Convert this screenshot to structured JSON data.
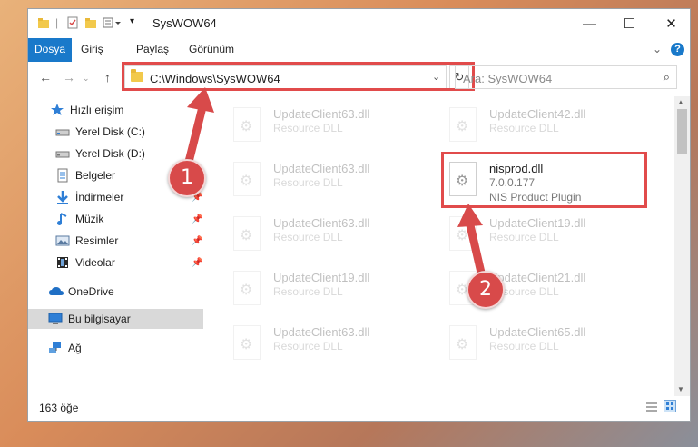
{
  "window": {
    "title": "SysWOW64",
    "controls": {
      "minimize": "—",
      "maximize": "☐",
      "close": "✕"
    }
  },
  "ribbon": {
    "tabs": [
      "Dosya",
      "Giriş",
      "Paylaş",
      "Görünüm"
    ],
    "collapse": "⌄",
    "help": "?"
  },
  "address": {
    "path": "C:\\Windows\\SysWOW64",
    "search_placeholder": "Ara: SysWOW64"
  },
  "sidebar": {
    "items": [
      {
        "label": "Hızlı erişim",
        "icon": "star-icon",
        "pinned": false
      },
      {
        "label": "Yerel Disk (C:)",
        "icon": "drive-icon",
        "pinned": false
      },
      {
        "label": "Yerel Disk (D:)",
        "icon": "drive-icon",
        "pinned": false
      },
      {
        "label": "Belgeler",
        "icon": "documents-icon",
        "pinned": true
      },
      {
        "label": "İndirmeler",
        "icon": "download-icon",
        "pinned": true
      },
      {
        "label": "Müzik",
        "icon": "music-icon",
        "pinned": true
      },
      {
        "label": "Resimler",
        "icon": "pictures-icon",
        "pinned": true
      },
      {
        "label": "Videolar",
        "icon": "videos-icon",
        "pinned": true
      },
      {
        "label": "OneDrive",
        "icon": "cloud-icon",
        "pinned": false
      },
      {
        "label": "Bu bilgisayar",
        "icon": "computer-icon",
        "pinned": false
      },
      {
        "label": "Ağ",
        "icon": "network-icon",
        "pinned": false
      }
    ]
  },
  "files": [
    {
      "name": "UpdateClient63.dll",
      "type": "Resource DLL",
      "faded": true
    },
    {
      "name": "UpdateClient42.dll",
      "type": "Resource DLL",
      "faded": true
    },
    {
      "name": "UpdateClient63.dll",
      "type": "Resource DLL",
      "faded": true
    },
    {
      "name": "nisprod.dll",
      "type": "7.0.0.177",
      "desc": "NIS Product Plugin",
      "faded": false
    },
    {
      "name": "UpdateClient63.dll",
      "type": "Resource DLL",
      "faded": true
    },
    {
      "name": "UpdateClient19.dll",
      "type": "Resource DLL",
      "faded": true
    },
    {
      "name": "UpdateClient19.dll",
      "type": "Resource DLL",
      "faded": true
    },
    {
      "name": "UpdateClient21.dll",
      "type": "Resource DLL",
      "faded": true
    },
    {
      "name": "UpdateClient63.dll",
      "type": "Resource DLL",
      "faded": true
    },
    {
      "name": "UpdateClient65.dll",
      "type": "Resource DLL",
      "faded": true
    }
  ],
  "status": {
    "count": "163 öğe"
  },
  "callouts": {
    "one": "1",
    "two": "2"
  },
  "colors": {
    "accent": "#1979ca",
    "highlight": "#e14b4b"
  }
}
